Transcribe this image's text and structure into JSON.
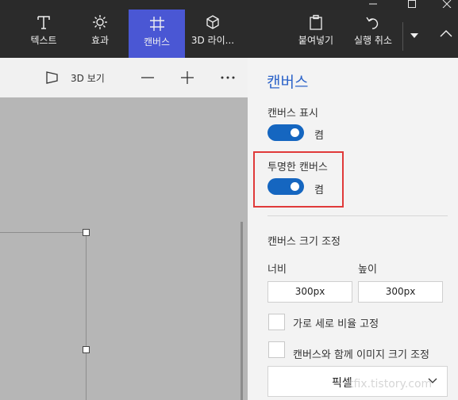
{
  "ribbon": {
    "tabs": [
      {
        "label": "텍스트",
        "icon": "text-icon"
      },
      {
        "label": "효과",
        "icon": "effects-icon"
      },
      {
        "label": "캔버스",
        "icon": "canvas-icon",
        "active": true
      },
      {
        "label": "3D 라이...",
        "icon": "3d-library-icon"
      }
    ],
    "paste_label": "붙여넣기",
    "undo_label": "실행 취소"
  },
  "toolbar": {
    "view3d_label": "3D 보기"
  },
  "panel": {
    "title": "캔버스",
    "show_canvas_label": "캔버스 표시",
    "show_canvas_state": "켬",
    "transparent_canvas_label": "투명한 캔버스",
    "transparent_canvas_state": "켬",
    "resize_label": "캔버스 크기 조정",
    "width_label": "너비",
    "height_label": "높이",
    "width_value": "300px",
    "height_value": "300px",
    "lock_aspect_label": "가로 세로 비율 고정",
    "resize_image_label": "캔버스와 함께 이미지 크기 조정",
    "unit_value": "픽셀"
  },
  "watermark": "tfix.tistory.com",
  "colors": {
    "accent": "#4a57d4",
    "toggle": "#1566c0",
    "title": "#2c63c9",
    "highlight": "#e03a3a"
  }
}
